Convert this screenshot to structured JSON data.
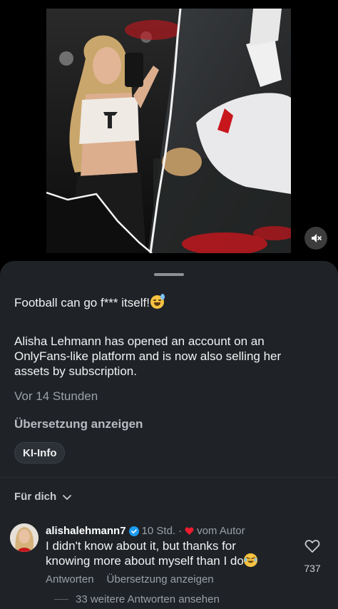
{
  "post": {
    "caption": "Football can go f*** itself!",
    "caption_emoji": "grinning-sweat-emoji",
    "description": "Alisha Lehmann has opened an account on an OnlyFans-like platform and is now also selling her assets by subscription.",
    "timestamp": "Vor 14 Stunden",
    "translate_label": "Übersetzung anzeigen",
    "ai_chip_label": "KI-Info"
  },
  "media": {
    "mute_icon": "speaker-muted-icon"
  },
  "comments": {
    "sort_label": "Für dich",
    "items": [
      {
        "author": "alishalehmann7",
        "verified": true,
        "time": "10 Std.",
        "liked_by_author": "vom Autor",
        "text": "I didn't know about it, but thanks for knowing more about myself than I do",
        "text_emoji": "rolling-laughing-emoji",
        "reply_label": "Antworten",
        "translate_label": "Übersetzung anzeigen",
        "likes": "737"
      }
    ],
    "more_replies_label": "33 weitere Antworten ansehen"
  },
  "colors": {
    "sheet_bg": "#1f2328",
    "verified_blue": "#1d9bf0",
    "heart_red": "#ed1c2e",
    "accent_red": "#c8161d"
  }
}
